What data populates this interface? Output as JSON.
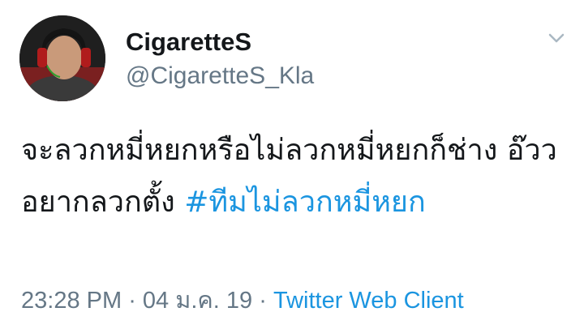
{
  "author": {
    "display_name": "CigaretteS",
    "handle": "@CigaretteS_Kla",
    "avatar_icon": "profile-photo"
  },
  "tweet": {
    "text": "จะลวกหมี่หยกหรือไม่ลวกหมี่หยกก็ช่าง อ๊ววอยากลวกตั้ง ",
    "hashtag": "#ทีมไม่ลวกหมี่หยก"
  },
  "meta": {
    "time": "23:28 PM",
    "separator_1": " · ",
    "date": "04 ม.ค. 19",
    "separator_2": " · ",
    "source": "Twitter Web Client"
  },
  "menu": {
    "icon": "chevron-down-icon"
  },
  "colors": {
    "link": "#1b95e0",
    "secondary_text": "#657786",
    "primary_text": "#14171a"
  }
}
